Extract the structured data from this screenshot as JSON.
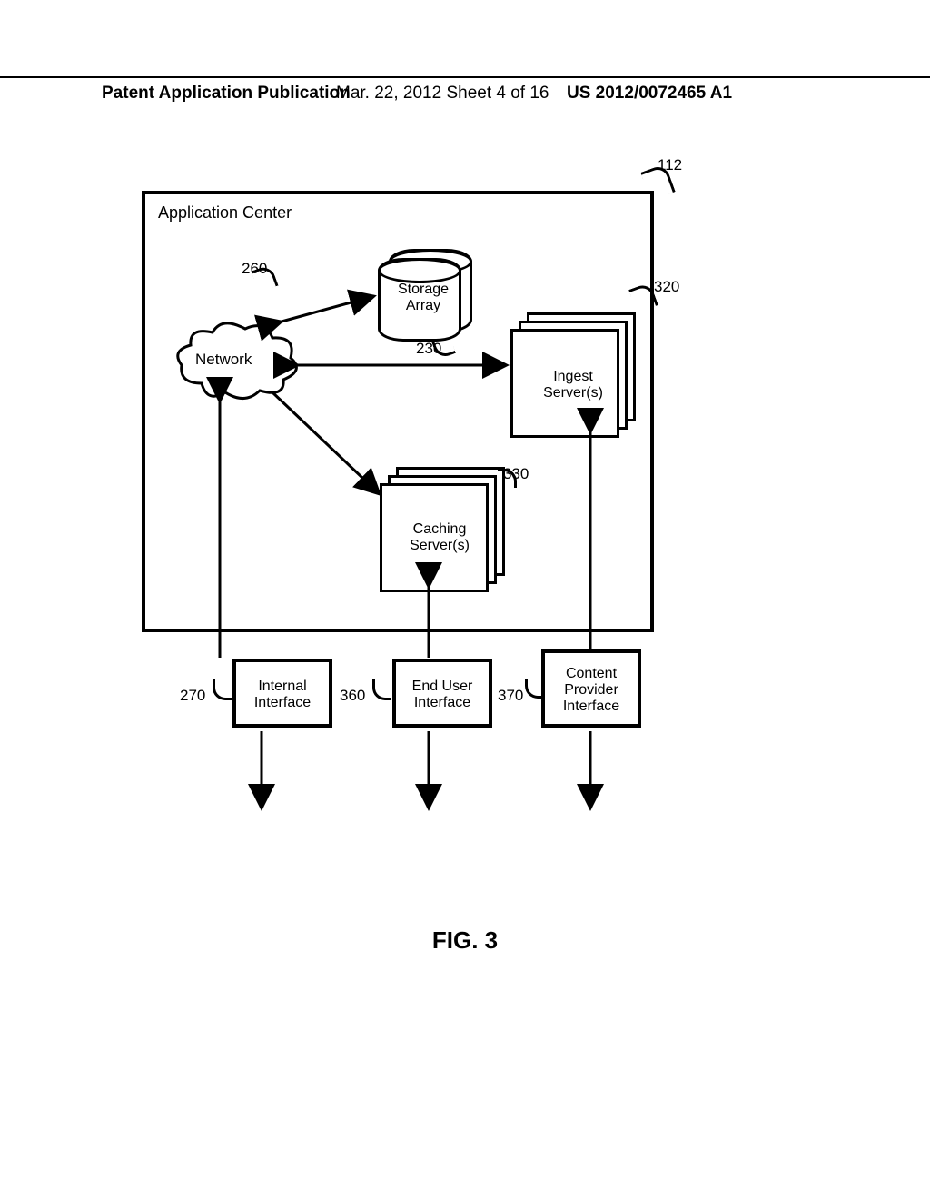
{
  "header": {
    "left": "Patent Application Publication",
    "mid": "Mar. 22, 2012  Sheet 4 of 16",
    "right": "US 2012/0072465 A1"
  },
  "diagram": {
    "container_label": "Application Center",
    "cloud": "Network",
    "storage": "Storage\nArray",
    "ingest": "Ingest\nServer(s)",
    "caching": "Caching\nServer(s)",
    "internal": "Internal\nInterface",
    "enduser": "End User\nInterface",
    "content": "Content\nProvider\nInterface"
  },
  "refs": {
    "r112": "112",
    "r260": "260",
    "r230": "230",
    "r320": "320",
    "r330": "330",
    "r270": "270",
    "r360": "360",
    "r370": "370"
  },
  "caption": "FIG. 3"
}
